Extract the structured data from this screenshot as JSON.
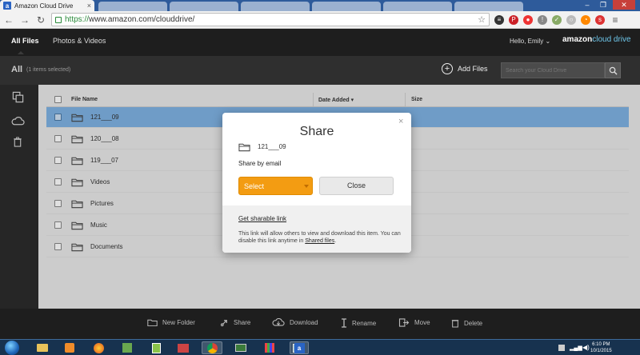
{
  "browser": {
    "active_tab_title": "Amazon Cloud Drive",
    "tab_favicon_letter": "a",
    "url_scheme": "https://",
    "url_rest": "www.amazon.com/clouddrive/"
  },
  "header": {
    "tabs": [
      {
        "label": "All Files",
        "active": true
      },
      {
        "label": "Photos & Videos",
        "active": false
      }
    ],
    "greeting": "Hello, Emily",
    "brand_amazon": "amazon",
    "brand_product": "cloud drive"
  },
  "actionbar": {
    "all_label": "All",
    "selected_count": "(1 items selected)",
    "add_files_label": "Add Files",
    "search_placeholder": "Search your Cloud Drive"
  },
  "list": {
    "columns": {
      "name": "File Name",
      "date": "Date Added",
      "size": "Size"
    },
    "rows": [
      {
        "name": "121___09",
        "selected": true
      },
      {
        "name": "120___08",
        "selected": false
      },
      {
        "name": "119___07",
        "selected": false
      },
      {
        "name": "Videos",
        "selected": false
      },
      {
        "name": "Pictures",
        "selected": false
      },
      {
        "name": "Music",
        "selected": false
      },
      {
        "name": "Documents",
        "selected": false
      }
    ]
  },
  "modal": {
    "title": "Share",
    "close_glyph": "×",
    "folder_name": "121___09",
    "share_by_email_label": "Share by email",
    "select_label": "Select",
    "close_button_label": "Close",
    "sharable_link_label": "Get sharable link",
    "description_prefix": "This link will allow others to view and download this item. You can disable this link anytime in ",
    "description_link": "Shared files",
    "description_suffix": "."
  },
  "footer_actions": [
    {
      "label": "New Folder",
      "icon": "folder-icon"
    },
    {
      "label": "Share",
      "icon": "share-icon"
    },
    {
      "label": "Download",
      "icon": "download-icon"
    },
    {
      "label": "Rename",
      "icon": "rename-icon"
    },
    {
      "label": "Move",
      "icon": "move-icon"
    },
    {
      "label": "Delete",
      "icon": "trash-icon"
    }
  ],
  "taskbar": {
    "time": "6:10 PM",
    "date": "10/1/2015"
  },
  "colors": {
    "select_button": "#f39c12",
    "selected_row": "#7fb2e3",
    "dark_header": "#1e1e1e"
  }
}
